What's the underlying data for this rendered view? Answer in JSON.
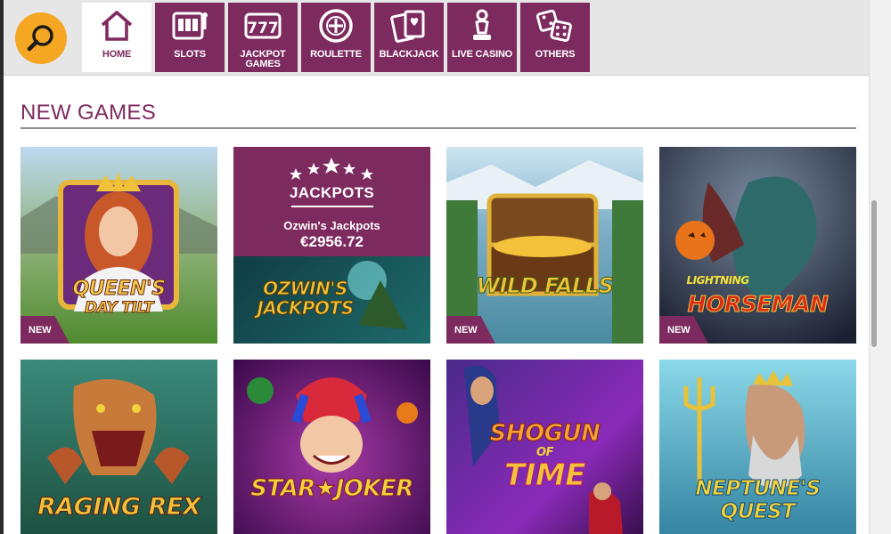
{
  "nav": {
    "search_icon": "magnifier-icon",
    "items": [
      {
        "label": "HOME",
        "icon": "home-icon",
        "active": true
      },
      {
        "label": "SLOTS",
        "icon": "slot-machine-icon"
      },
      {
        "label": "JACKPOT GAMES",
        "label_line1": "JACKPOT",
        "label_line2": "GAMES",
        "icon": "777-icon",
        "icon_text": "777"
      },
      {
        "label": "ROULETTE",
        "icon": "roulette-icon"
      },
      {
        "label": "BLACKJACK",
        "icon": "cards-icon"
      },
      {
        "label": "LIVE CASINO",
        "icon": "chess-piece-icon"
      },
      {
        "label": "OTHERS",
        "icon": "dice-icon"
      }
    ]
  },
  "section": {
    "title": "NEW GAMES"
  },
  "badge": {
    "new": "NEW"
  },
  "games": [
    {
      "title_line1": "QUEEN'S",
      "title_line2": "DAY TILT",
      "badge": "NEW"
    },
    {
      "type": "jackpot",
      "header": "JACKPOTS",
      "name": "Ozwin's Jackpots",
      "amount": "€2956.72",
      "title_line1": "OZWIN'S",
      "title_line2": "JACKPOTS"
    },
    {
      "title_line1": "WILD FALLS",
      "badge": "NEW"
    },
    {
      "title_small": "LIGHTNING",
      "title_line1": "HORSEMAN",
      "badge": "NEW"
    },
    {
      "title_line1": "RAGING REX"
    },
    {
      "title_line1": "STAR★JOKER"
    },
    {
      "title_line1": "SHOGUN",
      "title_small": "OF",
      "title_line2": "TIME"
    },
    {
      "title_line1": "NEPTUNE'S",
      "title_line2": "QUEST"
    }
  ],
  "colors": {
    "brand": "#7d2a5f",
    "search": "#f5a623"
  }
}
